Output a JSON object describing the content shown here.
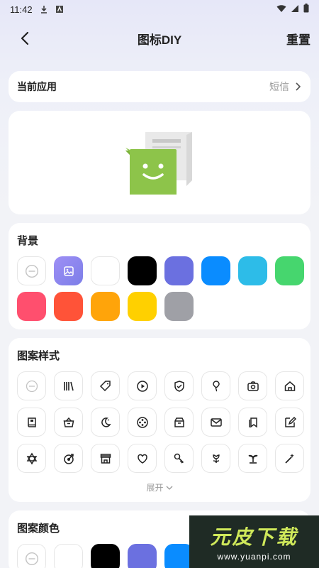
{
  "status_bar": {
    "time": "11:42"
  },
  "header": {
    "title": "图标DIY",
    "reset_label": "重置"
  },
  "current_app": {
    "label": "当前应用",
    "value": "短信"
  },
  "background": {
    "title": "背景",
    "swatches": [
      {
        "type": "none",
        "color": "#ffffff"
      },
      {
        "type": "image",
        "color": "#8f86f0"
      },
      {
        "type": "color",
        "color": "#ffffff"
      },
      {
        "type": "color",
        "color": "#000000"
      },
      {
        "type": "color",
        "color": "#6b70e0"
      },
      {
        "type": "color",
        "color": "#0a8cff"
      },
      {
        "type": "color",
        "color": "#2dbce8"
      },
      {
        "type": "color",
        "color": "#46d66e"
      },
      {
        "type": "color",
        "color": "#ff4f6e"
      },
      {
        "type": "color",
        "color": "#ff5338"
      },
      {
        "type": "color",
        "color": "#ffa40a"
      },
      {
        "type": "color",
        "color": "#ffd000"
      },
      {
        "type": "color",
        "color": "#9fa0a6"
      }
    ]
  },
  "pattern": {
    "title": "图案样式",
    "expand_label": "展开",
    "icons": [
      "none-icon",
      "books-icon",
      "tag-icon",
      "play-icon",
      "shield-check-icon",
      "balloon-icon",
      "camera-icon",
      "home-icon",
      "book-icon",
      "basket-icon",
      "moon-icon",
      "film-reel-icon",
      "box-icon",
      "mail-icon",
      "bookmark-icon",
      "edit-icon",
      "star-of-david-icon",
      "target-icon",
      "store-icon",
      "heart-icon",
      "key-icon",
      "flower-icon",
      "palm-tree-icon",
      "magic-wand-icon"
    ]
  },
  "pattern_color": {
    "title": "图案颜色",
    "swatches": [
      "#ffffff",
      "#ffffff",
      "#000000",
      "#6b70e0",
      "#0a8cff"
    ]
  },
  "watermark": {
    "title": "元皮下载",
    "url": "www.yuanpi.com"
  }
}
